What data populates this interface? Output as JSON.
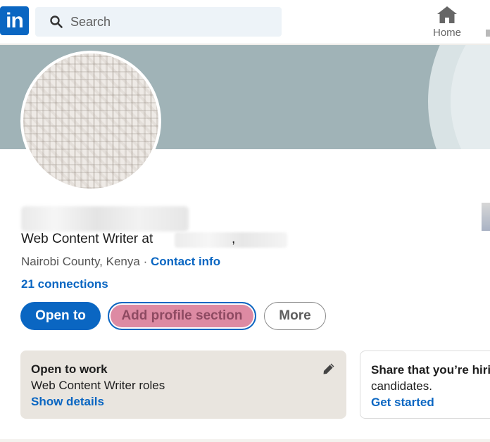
{
  "topbar": {
    "logo_text": "in",
    "search": {
      "placeholder": "Search",
      "icon": "search-icon"
    },
    "nav": {
      "home_label": "Home",
      "home_icon": "home-icon"
    }
  },
  "profile": {
    "headline_prefix": "Web Content Writer at",
    "headline_comma": ",",
    "location": "Nairobi County, Kenya",
    "separator": " · ",
    "contact_info_label": "Contact info",
    "connections": "21 connections"
  },
  "actions": {
    "open_to_label": "Open to",
    "add_section_label": "Add profile section",
    "more_label": "More"
  },
  "open_to_work": {
    "title": "Open to work",
    "roles": "Web Content Writer roles",
    "link": "Show details",
    "edit_icon": "pencil-icon"
  },
  "hiring": {
    "title": "Share that you’re hiring",
    "subtitle": "candidates.",
    "link": "Get started"
  },
  "colors": {
    "brand": "#0a66c2",
    "banner": "#a0b3b7",
    "highlight": "#dd8aa3"
  }
}
